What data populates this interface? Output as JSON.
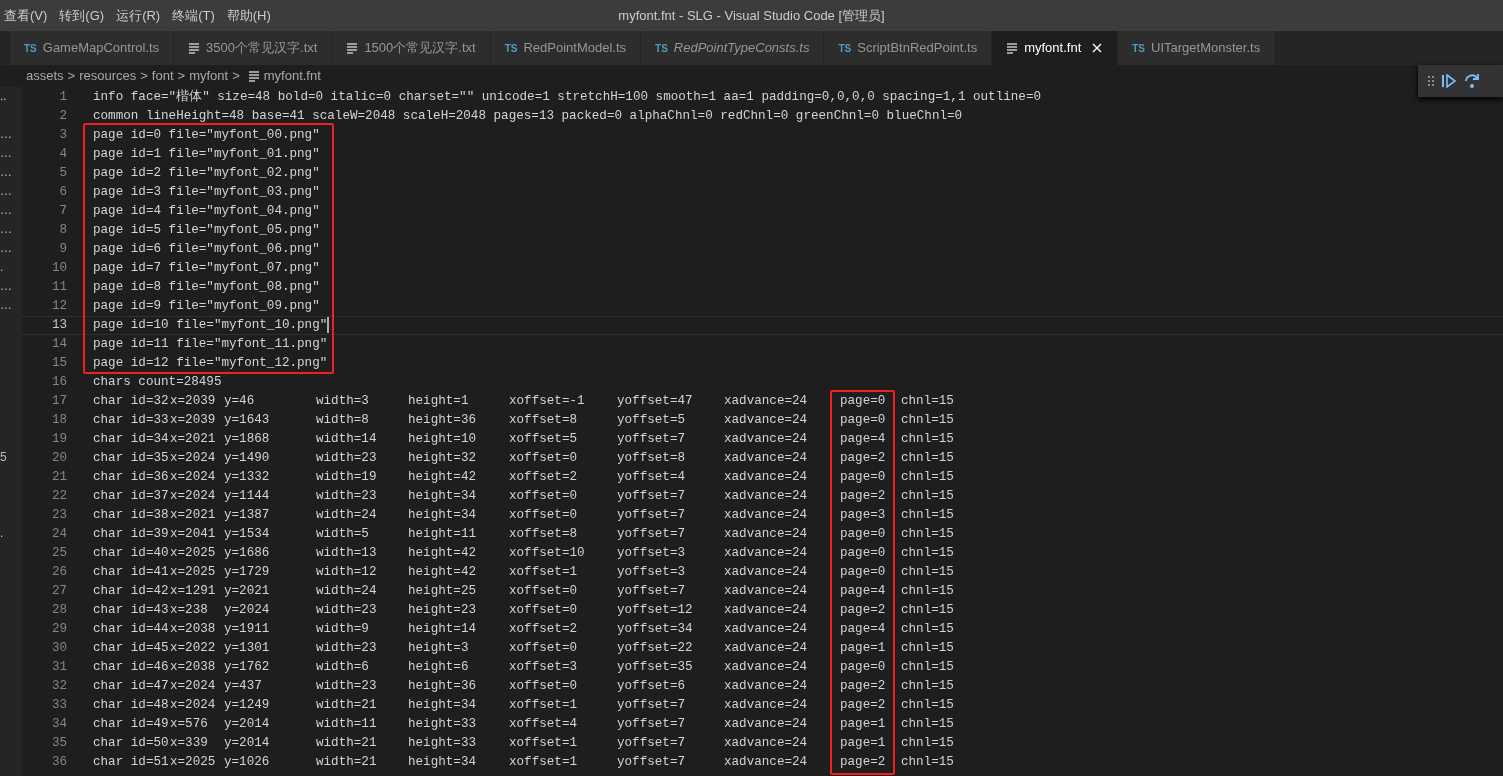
{
  "menu": [
    "查看(V)",
    "转到(G)",
    "运行(R)",
    "终端(T)",
    "帮助(H)"
  ],
  "window": {
    "title": "myfont.fnt - SLG - Visual Studio Code [管理员]"
  },
  "tabs": [
    {
      "label": "GameMapControl.ts",
      "badge": "TS",
      "italic": false,
      "selected": false
    },
    {
      "label": "3500个常见汉字.txt",
      "italic": false,
      "selected": false
    },
    {
      "label": "1500个常见汉字.txt",
      "italic": false,
      "selected": false
    },
    {
      "label": "RedPointModel.ts",
      "badge": "TS",
      "italic": false,
      "selected": false
    },
    {
      "label": "RedPointTypeConsts.ts",
      "badge": "TS",
      "italic": true,
      "selected": false
    },
    {
      "label": "ScriptBtnRedPoint.ts",
      "badge": "TS",
      "italic": false,
      "selected": false
    },
    {
      "label": "myfont.fnt",
      "italic": false,
      "selected": true
    },
    {
      "label": "UITargetMonster.ts",
      "badge": "TS",
      "italic": false,
      "selected": false
    }
  ],
  "breadcrumb": {
    "folders": [
      "assets",
      "resources",
      "font",
      "myfont"
    ],
    "file": "myfont.fnt",
    "separator": ">"
  },
  "lines": [
    {
      "number": "1",
      "kind": "text",
      "text": "info face=\"楷体\" size=48 bold=0 italic=0 charset=\"\" unicode=1 stretchH=100 smooth=1 aa=1 padding=0,0,0,0 spacing=1,1 outline=0",
      "boxed": false,
      "current": false,
      "side_mark": "‥"
    },
    {
      "number": "2",
      "kind": "text",
      "text": "common lineHeight=48 base=41 scaleW=2048 scaleH=2048 pages=13 packed=0 alphaChnl=0 redChnl=0 greenChnl=0 blueChnl=0",
      "boxed": false,
      "current": false
    },
    {
      "number": "3",
      "kind": "text",
      "text": "page id=0 file=\"myfont_00.png\"",
      "boxed": true,
      "current": false,
      "side_mark": "…"
    },
    {
      "number": "4",
      "kind": "text",
      "text": "page id=1 file=\"myfont_01.png\"",
      "boxed": true,
      "current": false,
      "side_mark": "…"
    },
    {
      "number": "5",
      "kind": "text",
      "text": "page id=2 file=\"myfont_02.png\"",
      "boxed": true,
      "current": false,
      "side_mark": "…"
    },
    {
      "number": "6",
      "kind": "text",
      "text": "page id=3 file=\"myfont_03.png\"",
      "boxed": true,
      "current": false,
      "side_mark": "…"
    },
    {
      "number": "7",
      "kind": "text",
      "text": "page id=4 file=\"myfont_04.png\"",
      "boxed": true,
      "current": false,
      "side_mark": "…"
    },
    {
      "number": "8",
      "kind": "text",
      "text": "page id=5 file=\"myfont_05.png\"",
      "boxed": true,
      "current": false,
      "side_mark": "…"
    },
    {
      "number": "9",
      "kind": "text",
      "text": "page id=6 file=\"myfont_06.png\"",
      "boxed": true,
      "current": false,
      "side_mark": "…"
    },
    {
      "number": "10",
      "kind": "text",
      "text": "page id=7 file=\"myfont_07.png\"",
      "boxed": true,
      "current": false,
      "side_mark": "."
    },
    {
      "number": "11",
      "kind": "text",
      "text": "page id=8 file=\"myfont_08.png\"",
      "boxed": true,
      "current": false,
      "side_mark": "…"
    },
    {
      "number": "12",
      "kind": "text",
      "text": "page id=9 file=\"myfont_09.png\"",
      "boxed": true,
      "current": false,
      "side_mark": "…"
    },
    {
      "number": "13",
      "kind": "text",
      "text": "page id=10 file=\"myfont_10.png\"",
      "boxed": true,
      "current": true
    },
    {
      "number": "14",
      "kind": "text",
      "text": "page id=11 file=\"myfont_11.png\"",
      "boxed": true,
      "current": false
    },
    {
      "number": "15",
      "kind": "text",
      "text": "page id=12 file=\"myfont_12.png\"",
      "boxed": true,
      "current": false
    },
    {
      "number": "16",
      "kind": "text",
      "text": "chars count=28495",
      "boxed": false,
      "current": false
    },
    {
      "number": "17",
      "kind": "record",
      "fields": [
        "char id=32",
        "x=2039",
        "y=46",
        "width=3",
        "height=1",
        "xoffset=-1",
        "yoffset=47",
        "xadvance=24",
        "page=0",
        "chnl=15"
      ],
      "boxed": true,
      "current": false
    },
    {
      "number": "18",
      "kind": "record",
      "fields": [
        "char id=33",
        "x=2039",
        "y=1643",
        "width=8",
        "height=36",
        "xoffset=8",
        "yoffset=5",
        "xadvance=24",
        "page=0",
        "chnl=15"
      ],
      "boxed": true,
      "current": false
    },
    {
      "number": "19",
      "kind": "record",
      "fields": [
        "char id=34",
        "x=2021",
        "y=1868",
        "width=14",
        "height=10",
        "xoffset=5",
        "yoffset=7",
        "xadvance=24",
        "page=4",
        "chnl=15"
      ],
      "boxed": true,
      "current": false
    },
    {
      "number": "20",
      "kind": "record",
      "fields": [
        "char id=35",
        "x=2024",
        "y=1490",
        "width=23",
        "height=32",
        "xoffset=0",
        "yoffset=8",
        "xadvance=24",
        "page=2",
        "chnl=15"
      ],
      "boxed": true,
      "current": false,
      "side_mark": "5"
    },
    {
      "number": "21",
      "kind": "record",
      "fields": [
        "char id=36",
        "x=2024",
        "y=1332",
        "width=19",
        "height=42",
        "xoffset=2",
        "yoffset=4",
        "xadvance=24",
        "page=0",
        "chnl=15"
      ],
      "boxed": true,
      "current": false
    },
    {
      "number": "22",
      "kind": "record",
      "fields": [
        "char id=37",
        "x=2024",
        "y=1144",
        "width=23",
        "height=34",
        "xoffset=0",
        "yoffset=7",
        "xadvance=24",
        "page=2",
        "chnl=15"
      ],
      "boxed": true,
      "current": false
    },
    {
      "number": "23",
      "kind": "record",
      "fields": [
        "char id=38",
        "x=2021",
        "y=1387",
        "width=24",
        "height=34",
        "xoffset=0",
        "yoffset=7",
        "xadvance=24",
        "page=3",
        "chnl=15"
      ],
      "boxed": true,
      "current": false
    },
    {
      "number": "24",
      "kind": "record",
      "fields": [
        "char id=39",
        "x=2041",
        "y=1534",
        "width=5",
        "height=11",
        "xoffset=8",
        "yoffset=7",
        "xadvance=24",
        "page=0",
        "chnl=15"
      ],
      "boxed": true,
      "current": false,
      "side_mark": "."
    },
    {
      "number": "25",
      "kind": "record",
      "fields": [
        "char id=40",
        "x=2025",
        "y=1686",
        "width=13",
        "height=42",
        "xoffset=10",
        "yoffset=3",
        "xadvance=24",
        "page=0",
        "chnl=15"
      ],
      "boxed": true,
      "current": false
    },
    {
      "number": "26",
      "kind": "record",
      "fields": [
        "char id=41",
        "x=2025",
        "y=1729",
        "width=12",
        "height=42",
        "xoffset=1",
        "yoffset=3",
        "xadvance=24",
        "page=0",
        "chnl=15"
      ],
      "boxed": true,
      "current": false
    },
    {
      "number": "27",
      "kind": "record",
      "fields": [
        "char id=42",
        "x=1291",
        "y=2021",
        "width=24",
        "height=25",
        "xoffset=0",
        "yoffset=7",
        "xadvance=24",
        "page=4",
        "chnl=15"
      ],
      "boxed": true,
      "current": false
    },
    {
      "number": "28",
      "kind": "record",
      "fields": [
        "char id=43",
        "x=238",
        "y=2024",
        "width=23",
        "height=23",
        "xoffset=0",
        "yoffset=12",
        "xadvance=24",
        "page=2",
        "chnl=15"
      ],
      "boxed": true,
      "current": false
    },
    {
      "number": "29",
      "kind": "record",
      "fields": [
        "char id=44",
        "x=2038",
        "y=1911",
        "width=9",
        "height=14",
        "xoffset=2",
        "yoffset=34",
        "xadvance=24",
        "page=4",
        "chnl=15"
      ],
      "boxed": true,
      "current": false
    },
    {
      "number": "30",
      "kind": "record",
      "fields": [
        "char id=45",
        "x=2022",
        "y=1301",
        "width=23",
        "height=3",
        "xoffset=0",
        "yoffset=22",
        "xadvance=24",
        "page=1",
        "chnl=15"
      ],
      "boxed": true,
      "current": false
    },
    {
      "number": "31",
      "kind": "record",
      "fields": [
        "char id=46",
        "x=2038",
        "y=1762",
        "width=6",
        "height=6",
        "xoffset=3",
        "yoffset=35",
        "xadvance=24",
        "page=0",
        "chnl=15"
      ],
      "boxed": true,
      "current": false
    },
    {
      "number": "32",
      "kind": "record",
      "fields": [
        "char id=47",
        "x=2024",
        "y=437",
        "width=23",
        "height=36",
        "xoffset=0",
        "yoffset=6",
        "xadvance=24",
        "page=2",
        "chnl=15"
      ],
      "boxed": true,
      "current": false
    },
    {
      "number": "33",
      "kind": "record",
      "fields": [
        "char id=48",
        "x=2024",
        "y=1249",
        "width=21",
        "height=34",
        "xoffset=1",
        "yoffset=7",
        "xadvance=24",
        "page=2",
        "chnl=15"
      ],
      "boxed": true,
      "current": false
    },
    {
      "number": "34",
      "kind": "record",
      "fields": [
        "char id=49",
        "x=576",
        "y=2014",
        "width=11",
        "height=33",
        "xoffset=4",
        "yoffset=7",
        "xadvance=24",
        "page=1",
        "chnl=15"
      ],
      "boxed": true,
      "current": false
    },
    {
      "number": "35",
      "kind": "record",
      "fields": [
        "char id=50",
        "x=339",
        "y=2014",
        "width=21",
        "height=33",
        "xoffset=1",
        "yoffset=7",
        "xadvance=24",
        "page=1",
        "chnl=15"
      ],
      "boxed": true,
      "current": false
    },
    {
      "number": "36",
      "kind": "record",
      "fields": [
        "char id=51",
        "x=2025",
        "y=1026",
        "width=21",
        "height=34",
        "xoffset=1",
        "yoffset=7",
        "xadvance=24",
        "page=2",
        "chnl=15"
      ],
      "boxed": true,
      "current": false
    }
  ]
}
